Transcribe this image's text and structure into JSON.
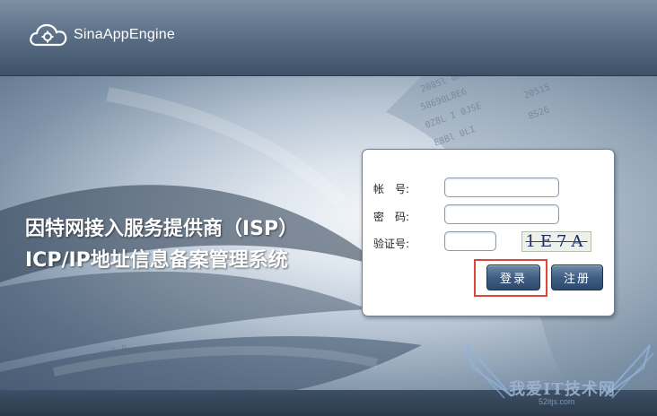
{
  "header": {
    "brand": "SinaAppEngine",
    "logo_icon": "cloud-gear-icon"
  },
  "title": {
    "line1": "因特网接入服务提供商（ISP）",
    "line2": "ICP/IP地址信息备案管理系统"
  },
  "form": {
    "account_label": "帐　号:",
    "password_label": "密　码:",
    "captcha_label": "验证号:",
    "account_value": "",
    "password_value": "",
    "captcha_value": "",
    "captcha_text": "1E7A",
    "login_label": "登录",
    "register_label": "注册"
  },
  "watermark": {
    "text": "我爱IT技术网",
    "url": "52itjs.com"
  },
  "colors": {
    "header": "#566b82",
    "button": "#3f5e82",
    "highlight": "#e0443b"
  }
}
